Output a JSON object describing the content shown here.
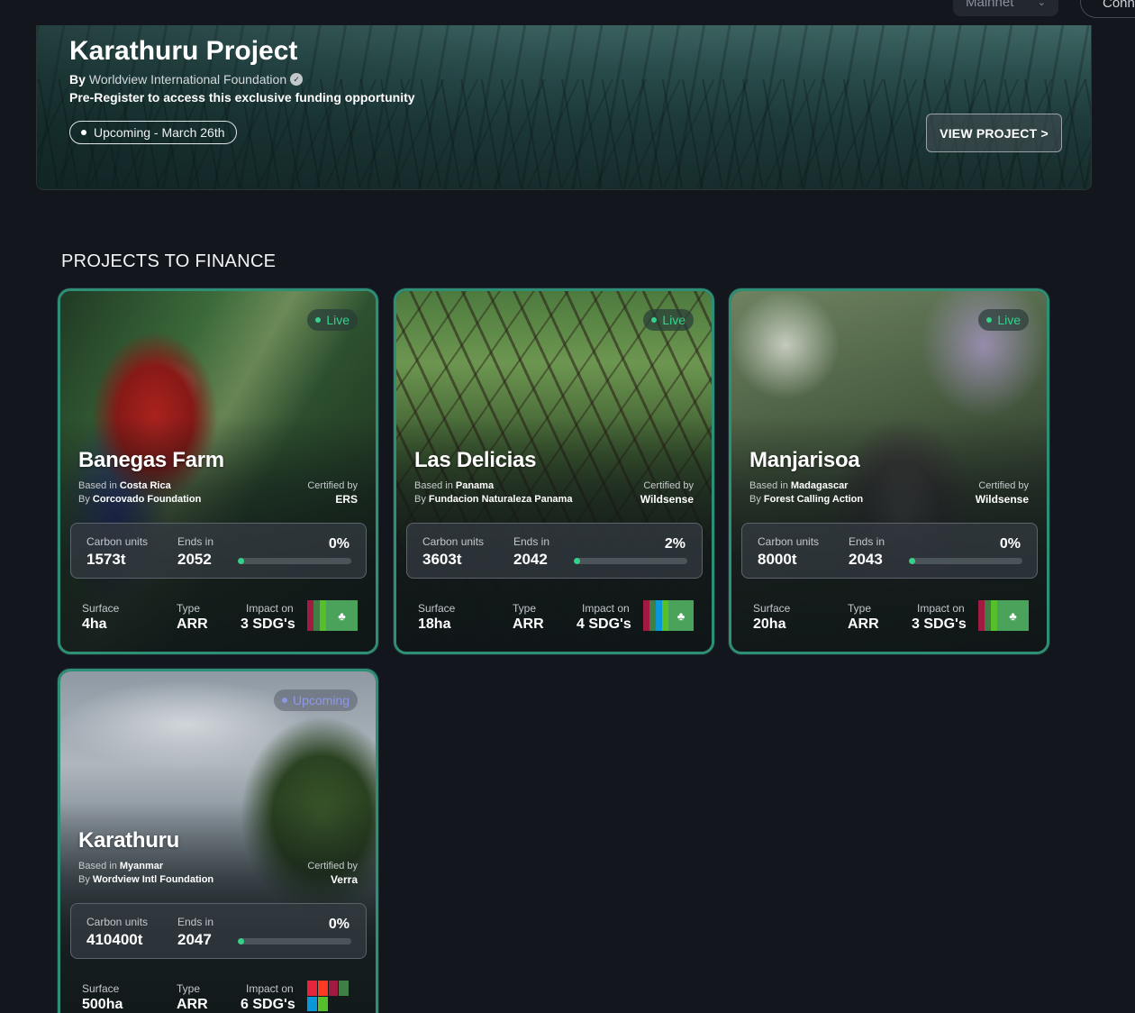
{
  "header": {
    "network": "Mainnet",
    "connect_label": "Conn"
  },
  "hero": {
    "title": "Karathuru Project",
    "by_prefix": "By",
    "by_org": "Worldview International Foundation",
    "subtitle": "Pre-Register to access this exclusive funding opportunity",
    "status": "Upcoming - March 26th",
    "button": "VIEW PROJECT >"
  },
  "section": {
    "title": "PROJECTS TO FINANCE"
  },
  "labels": {
    "based_in": "Based in",
    "by": "By",
    "certified_by": "Certified by",
    "carbon_units": "Carbon units",
    "ends_in": "Ends in",
    "surface": "Surface",
    "type": "Type",
    "impact_on": "Impact on"
  },
  "colors": {
    "accent_green": "#35d18c",
    "card_border": "#2f8f76",
    "upcoming": "#8e97e6",
    "background": "#13161d"
  },
  "projects": [
    {
      "status": "Live",
      "name": "Banegas Farm",
      "country": "Costa Rica",
      "org": "Corcovado Foundation",
      "certifier": "ERS",
      "carbon_units": "1573t",
      "ends_in": "2052",
      "progress_label": "0%",
      "progress": 0,
      "surface": "4ha",
      "type": "ARR",
      "impact": "3 SDG's",
      "sdg_icons": [
        "sdg-8-icon",
        "sdg-13-icon",
        "sdg-15-icon"
      ]
    },
    {
      "status": "Live",
      "name": "Las Delicias",
      "country": "Panama",
      "org": "Fundacion Naturaleza Panama",
      "certifier": "Wildsense",
      "carbon_units": "3603t",
      "ends_in": "2042",
      "progress_label": "2%",
      "progress": 2,
      "surface": "18ha",
      "type": "ARR",
      "impact": "4 SDG's",
      "sdg_icons": [
        "sdg-8-icon",
        "sdg-13-icon",
        "sdg-14-icon",
        "sdg-15-icon"
      ]
    },
    {
      "status": "Live",
      "name": "Manjarisoa",
      "country": "Madagascar",
      "org": "Forest Calling Action",
      "certifier": "Wildsense",
      "carbon_units": "8000t",
      "ends_in": "2043",
      "progress_label": "0%",
      "progress": 0,
      "surface": "20ha",
      "type": "ARR",
      "impact": "3 SDG's",
      "sdg_icons": [
        "sdg-8-icon",
        "sdg-13-icon",
        "sdg-15-icon"
      ]
    },
    {
      "status": "Upcoming",
      "name": "Karathuru",
      "country": "Myanmar",
      "org": "Wordview Intl Foundation",
      "certifier": "Verra",
      "carbon_units": "410400t",
      "ends_in": "2047",
      "progress_label": "0%",
      "progress": 0,
      "surface": "500ha",
      "type": "ARR",
      "impact": "6 SDG's",
      "sdg_icons": [
        "sdg-1-icon",
        "sdg-5-icon",
        "sdg-8-icon",
        "sdg-13-icon",
        "sdg-14-icon",
        "sdg-15-icon"
      ]
    }
  ]
}
